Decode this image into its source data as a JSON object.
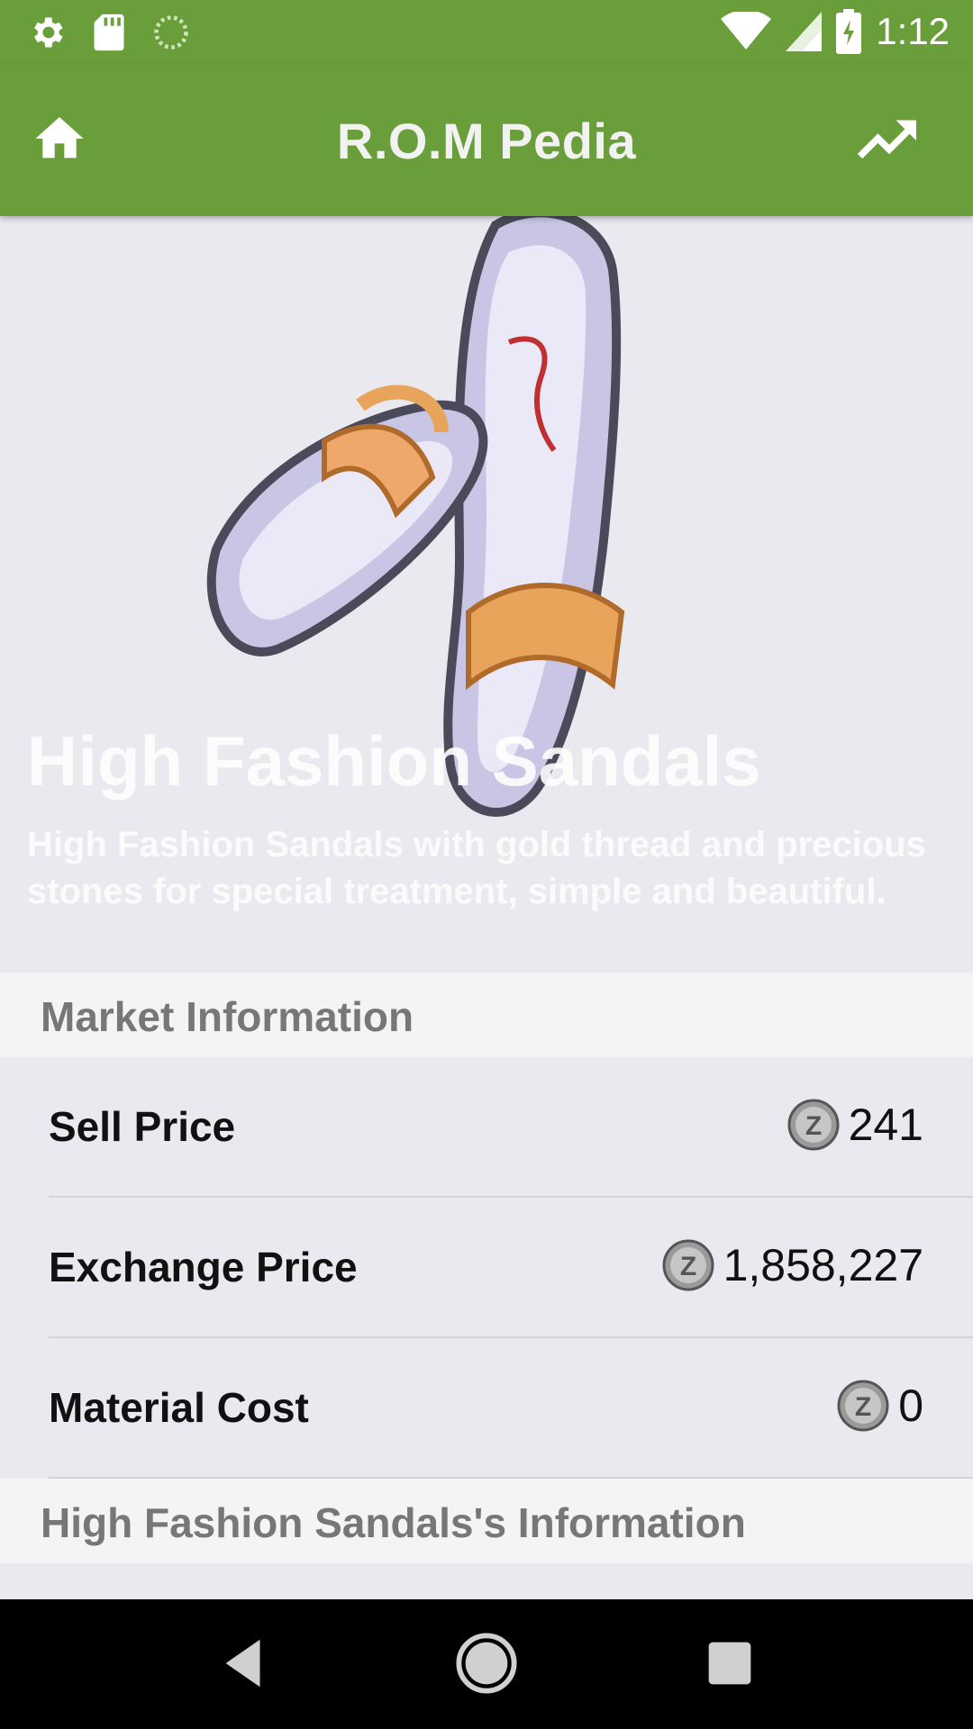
{
  "status_bar": {
    "time": "1:12",
    "icons": [
      "settings-icon",
      "sd-card-icon",
      "loading-icon",
      "wifi-icon",
      "signal-icon",
      "battery-charging-icon"
    ]
  },
  "app_bar": {
    "title": "R.O.M Pedia",
    "left_icon": "home-icon",
    "right_icon": "trending-up-icon",
    "color": "#6a9e3a"
  },
  "item": {
    "name": "High Fashion Sandals",
    "description": "High Fashion Sandals with gold thread and precious stones for special treatment, simple and beautiful."
  },
  "market": {
    "header": "Market Information",
    "rows": [
      {
        "label": "Sell Price",
        "value": "241",
        "icon": "zeny-coin-icon"
      },
      {
        "label": "Exchange Price",
        "value": "1,858,227",
        "icon": "zeny-coin-icon"
      },
      {
        "label": "Material Cost",
        "value": "0",
        "icon": "zeny-coin-icon"
      }
    ]
  },
  "info_section": {
    "header": "High Fashion Sandals's Information"
  },
  "nav_bar": {
    "buttons": [
      "back-icon",
      "home-circle-icon",
      "recents-icon"
    ]
  }
}
